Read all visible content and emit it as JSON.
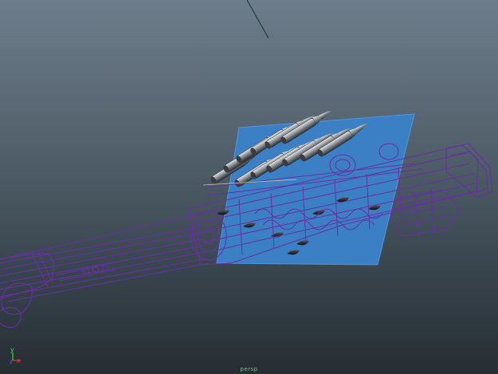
{
  "viewport": {
    "camera_label": "persp",
    "background_top": "#6e7d8b",
    "background_bottom": "#262d33"
  },
  "axis_gizmo": {
    "y_label": "y",
    "x_label": "x",
    "z_label": "z",
    "y_color": "#3ddc3d",
    "x_color": "#e03c3c",
    "z_color": "#3c6ee0"
  },
  "scene": {
    "reference_plane_color": "#3b7fc4",
    "wireframe_color": "#6a2ea8",
    "cartridge_count": 12
  }
}
